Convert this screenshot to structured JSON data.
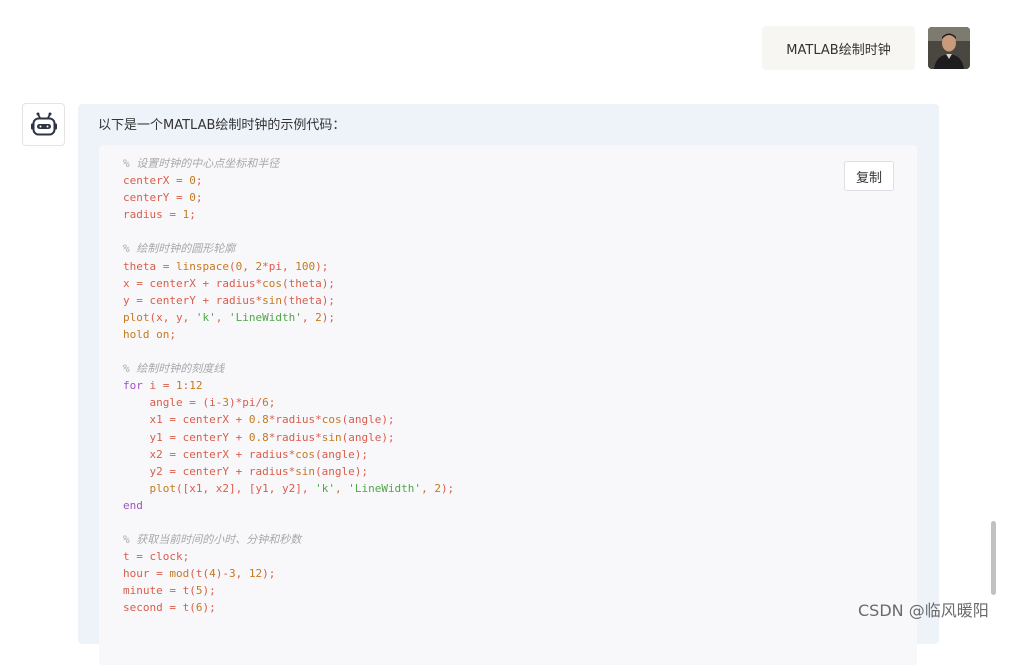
{
  "user_message": {
    "text": "MATLAB绘制时钟"
  },
  "bot_message": {
    "intro": "以下是一个MATLAB绘制时钟的示例代码："
  },
  "code_block": {
    "copy_label": "复制",
    "lines": [
      [
        [
          "c",
          "% 设置时钟的中心点坐标和半径"
        ]
      ],
      [
        [
          "p",
          "centerX = "
        ],
        [
          "n",
          "0"
        ],
        [
          "p",
          ";"
        ]
      ],
      [
        [
          "p",
          "centerY = "
        ],
        [
          "n",
          "0"
        ],
        [
          "p",
          ";"
        ]
      ],
      [
        [
          "p",
          "radius = "
        ],
        [
          "n",
          "1"
        ],
        [
          "p",
          ";"
        ]
      ],
      [],
      [
        [
          "c",
          "% 绘制时钟的圆形轮廓"
        ]
      ],
      [
        [
          "p",
          "theta = "
        ],
        [
          "f",
          "linspace"
        ],
        [
          "p",
          "("
        ],
        [
          "n",
          "0"
        ],
        [
          "p",
          ", "
        ],
        [
          "n",
          "2"
        ],
        [
          "p",
          "*pi, "
        ],
        [
          "n",
          "100"
        ],
        [
          "p",
          ");"
        ]
      ],
      [
        [
          "p",
          "x = centerX + radius*"
        ],
        [
          "f",
          "cos"
        ],
        [
          "p",
          "(theta);"
        ]
      ],
      [
        [
          "p",
          "y = centerY + radius*"
        ],
        [
          "f",
          "sin"
        ],
        [
          "p",
          "(theta);"
        ]
      ],
      [
        [
          "f",
          "plot"
        ],
        [
          "p",
          "(x, y, "
        ],
        [
          "s",
          "'k'"
        ],
        [
          "p",
          ", "
        ],
        [
          "s",
          "'LineWidth'"
        ],
        [
          "p",
          ", "
        ],
        [
          "n",
          "2"
        ],
        [
          "p",
          ");"
        ]
      ],
      [
        [
          "f",
          "hold"
        ],
        [
          "p",
          " "
        ],
        [
          "f",
          "on"
        ],
        [
          "p",
          ";"
        ]
      ],
      [],
      [
        [
          "c",
          "% 绘制时钟的刻度线"
        ]
      ],
      [
        [
          "k",
          "for"
        ],
        [
          "p",
          " i = "
        ],
        [
          "n",
          "1"
        ],
        [
          "p",
          ":"
        ],
        [
          "n",
          "12"
        ]
      ],
      [
        [
          "p",
          "    angle = (i-"
        ],
        [
          "n",
          "3"
        ],
        [
          "p",
          ")*pi/"
        ],
        [
          "n",
          "6"
        ],
        [
          "p",
          ";"
        ]
      ],
      [
        [
          "p",
          "    x1 = centerX + "
        ],
        [
          "n",
          "0.8"
        ],
        [
          "p",
          "*radius*"
        ],
        [
          "f",
          "cos"
        ],
        [
          "p",
          "(angle);"
        ]
      ],
      [
        [
          "p",
          "    y1 = centerY + "
        ],
        [
          "n",
          "0.8"
        ],
        [
          "p",
          "*radius*"
        ],
        [
          "f",
          "sin"
        ],
        [
          "p",
          "(angle);"
        ]
      ],
      [
        [
          "p",
          "    x2 = centerX + radius*"
        ],
        [
          "f",
          "cos"
        ],
        [
          "p",
          "(angle);"
        ]
      ],
      [
        [
          "p",
          "    y2 = centerY + radius*"
        ],
        [
          "f",
          "sin"
        ],
        [
          "p",
          "(angle);"
        ]
      ],
      [
        [
          "p",
          "    "
        ],
        [
          "f",
          "plot"
        ],
        [
          "p",
          "([x1, x2], [y1, y2], "
        ],
        [
          "s",
          "'k'"
        ],
        [
          "p",
          ", "
        ],
        [
          "s",
          "'LineWidth'"
        ],
        [
          "p",
          ", "
        ],
        [
          "n",
          "2"
        ],
        [
          "p",
          ");"
        ]
      ],
      [
        [
          "k",
          "end"
        ]
      ],
      [],
      [
        [
          "c",
          "% 获取当前时间的小时、分钟和秒数"
        ]
      ],
      [
        [
          "p",
          "t = clock;"
        ]
      ],
      [
        [
          "p",
          "hour = "
        ],
        [
          "f",
          "mod"
        ],
        [
          "p",
          "(t("
        ],
        [
          "n",
          "4"
        ],
        [
          "p",
          ")-"
        ],
        [
          "n",
          "3"
        ],
        [
          "p",
          ", "
        ],
        [
          "n",
          "12"
        ],
        [
          "p",
          ");"
        ]
      ],
      [
        [
          "p",
          "minute = t("
        ],
        [
          "n",
          "5"
        ],
        [
          "p",
          ");"
        ]
      ],
      [
        [
          "p",
          "second = t("
        ],
        [
          "n",
          "6"
        ],
        [
          "p",
          ");"
        ]
      ]
    ]
  },
  "watermark": {
    "text": "CSDN @临风暖阳"
  },
  "icons": {
    "user_avatar": "user-photo-avatar",
    "bot_avatar": "robot-icon"
  },
  "colors": {
    "comment": "#a8a8a8",
    "keyword": "#a452bf",
    "function": "#c37a1f",
    "string": "#52a64a",
    "plain": "#d95d4a",
    "panel": "#eef3fa"
  }
}
